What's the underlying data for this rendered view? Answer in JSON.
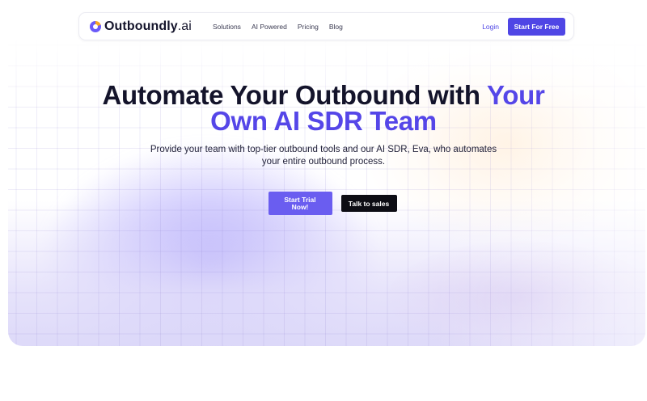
{
  "brand": {
    "name": "Outboundly",
    "suffix": ".ai",
    "accent_color": "#5546e8"
  },
  "nav": {
    "links": [
      "Solutions",
      "AI Powered",
      "Pricing",
      "Blog"
    ],
    "login_label": "Login",
    "cta_label": "Start For Free"
  },
  "hero": {
    "headline_prefix": "Automate Your Outbound with",
    "headline_accent_1": "Your",
    "headline_accent_2": "Own AI SDR Team",
    "subtext": "Provide your team with top-tier outbound tools and our AI SDR, Eva, who automates your entire outbound process.",
    "primary_cta": "Start Trial Now!",
    "secondary_cta": "Talk to sales"
  },
  "colors": {
    "primary": "#4f46e5",
    "trial_button": "#6a5df0",
    "dark_button": "#0d0d14"
  }
}
